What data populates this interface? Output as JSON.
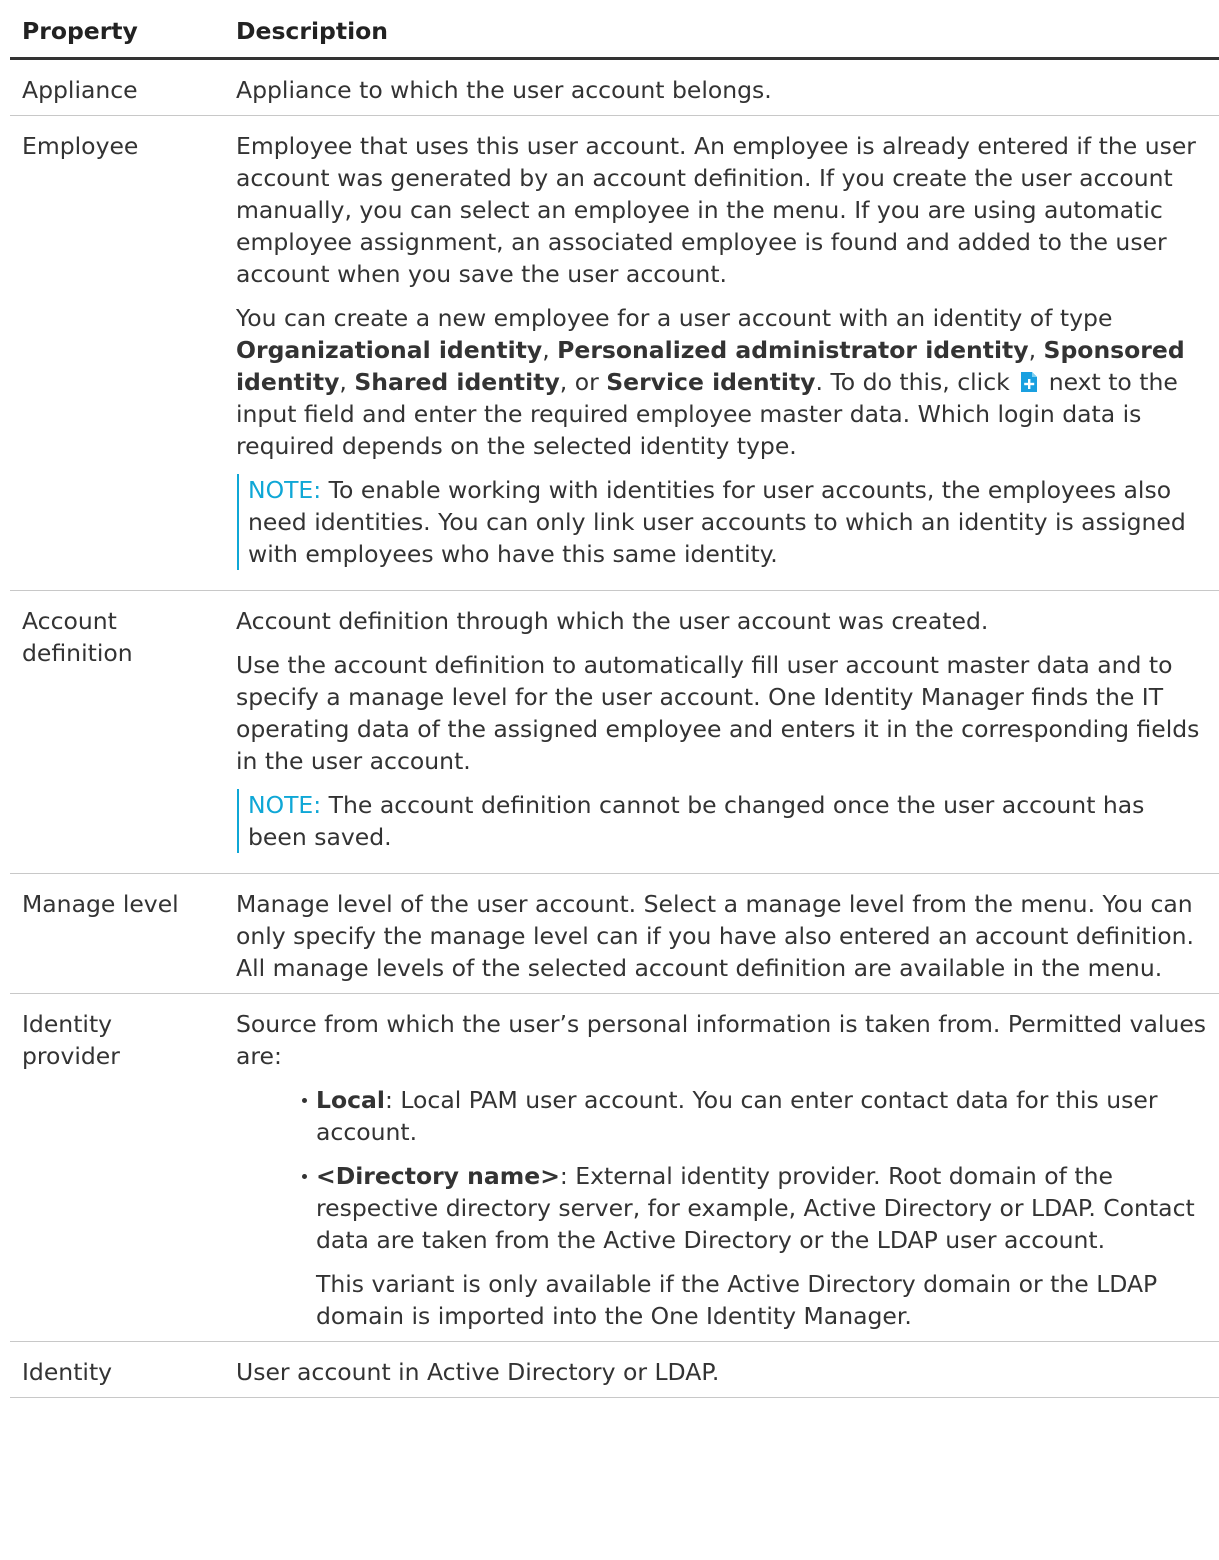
{
  "header": {
    "property": "Property",
    "description": "Description"
  },
  "rows": {
    "appliance": {
      "name": "Appliance",
      "desc": "Appliance to which the user account belongs."
    },
    "employee": {
      "name": "Employee",
      "p1": "Employee that uses this user account. An employee is already entered if the user account was generated by an account definition. If you create the user account manually, you can select an employee in the menu. If you are using automatic employee assignment, an associated employee is found and added to the user account when you save the user account.",
      "p2": {
        "t1": "You can create a new employee for a user account with an identity of type ",
        "b1": "Organizational identity",
        "t2": ", ",
        "b2": "Personalized administrator identity",
        "t3": ", ",
        "b3": "Sponsored identity",
        "t4": ", ",
        "b4": "Shared identity",
        "t5": ", or ",
        "b5": "Service identity",
        "t6": ". To do this, click ",
        "icon": "add-document-icon",
        "t7": " next to the input field and enter the required employee master data. Which login data is required depends on the selected identity type."
      },
      "note_label": "NOTE:",
      "note_text": " To enable working with identities for user accounts, the employees also need identities. You can only link user accounts to which an identity is assigned with employees who have this same identity."
    },
    "account_definition": {
      "name": "Account definition",
      "p1": "Account definition through which the user account was created.",
      "p2": "Use the account definition to automatically fill user account master data and to specify a manage level for the user account. One Identity Manager finds the IT operating data of the assigned employee and enters it in the corresponding fields in the user account.",
      "note_label": "NOTE:",
      "note_text": " The account definition cannot be changed once the user account has been saved."
    },
    "manage_level": {
      "name": "Manage level",
      "desc": "Manage level of the user account. Select a manage level from the menu. You can only specify the manage level can if you have also entered an account definition. All manage levels of the selected account definition are available in the menu."
    },
    "identity_provider": {
      "name": "Identity provider",
      "p1": "Source from which the user’s personal information is taken from. Permitted values are:",
      "bullets": [
        {
          "bold": "Local",
          "text": ": Local PAM user account. You can enter contact data for this user account."
        },
        {
          "bold": "<Directory name>",
          "text": ": External identity provider. Root domain of the respective directory server, for example, Active Directory or LDAP. Contact data are taken from the Active Directory or the LDAP user account."
        }
      ],
      "sub": "This variant is only available if the Active Directory domain or the LDAP domain is imported into the One Identity Manager."
    },
    "identity": {
      "name": "Identity",
      "desc": "User account in Active Directory or LDAP."
    }
  },
  "colors": {
    "text": "#333333",
    "note_accent": "#0fa7d6",
    "icon": "#1aa0e0"
  }
}
